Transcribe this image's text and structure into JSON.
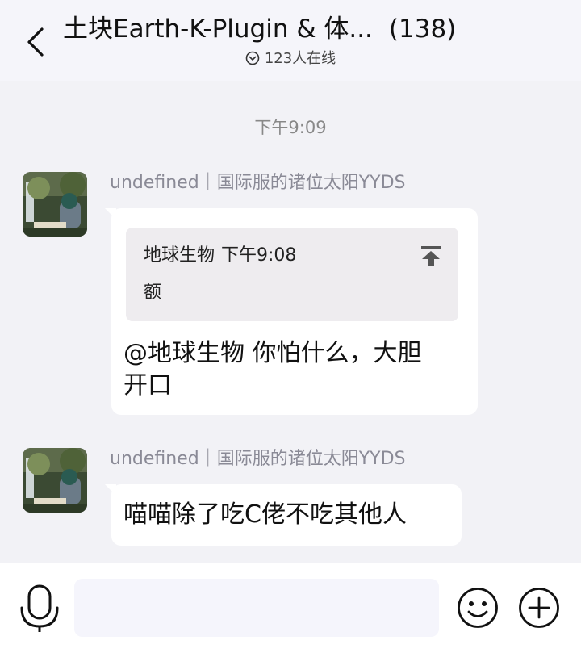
{
  "header": {
    "title": "土块Earth-K-Plugin & 体...",
    "member_count": "(138)",
    "online_text": "123人在线"
  },
  "chat": {
    "timestamp": "下午9:09",
    "messages": [
      {
        "sender": "undefined｜国际服的诸位太阳YYDS",
        "quote": {
          "author": "地球生物",
          "time": "下午9:08",
          "text": "额"
        },
        "text_line1": "@地球生物 你怕什么，大胆",
        "text_line2": "开口"
      },
      {
        "sender": "undefined｜国际服的诸位太阳YYDS",
        "text": "喵喵除了吃C佬不吃其他人"
      }
    ]
  },
  "footer": {
    "input_value": ""
  },
  "icons": {
    "back": "chevron-left-icon",
    "online": "circle-chevron-down-icon",
    "quote_jump": "arrow-up-to-top-icon",
    "voice": "microphone-icon",
    "emoji": "smiley-icon",
    "more": "plus-circle-icon"
  }
}
